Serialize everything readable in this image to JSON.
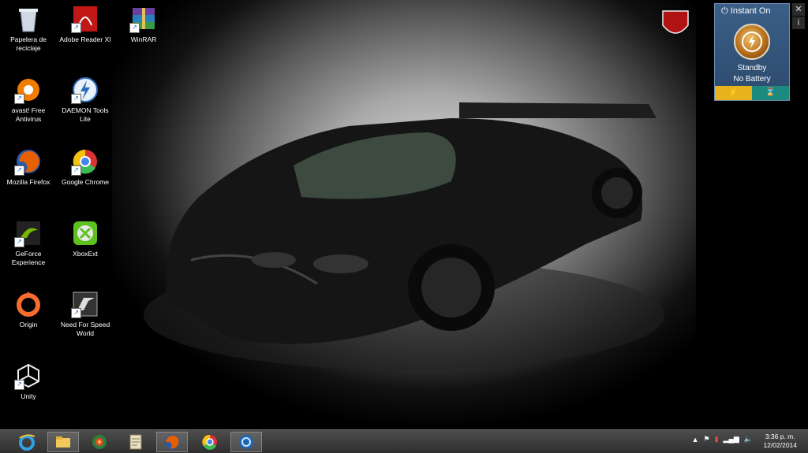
{
  "desktop": {
    "icons": [
      {
        "label": "Papelera de reciclaje",
        "icon": "recycle-bin-icon"
      },
      {
        "label": "Adobe Reader XI",
        "icon": "adobe-reader-icon"
      },
      {
        "label": "WinRAR",
        "icon": "winrar-icon"
      },
      {
        "label": "avast! Free Antivirus",
        "icon": "avast-icon"
      },
      {
        "label": "DAEMON Tools Lite",
        "icon": "daemon-tools-icon"
      },
      {
        "label": "Mozilla Firefox",
        "icon": "firefox-icon"
      },
      {
        "label": "Google Chrome",
        "icon": "chrome-icon"
      },
      {
        "label": "GeForce Experience",
        "icon": "geforce-icon"
      },
      {
        "label": "XboxExt",
        "icon": "xbox-icon"
      },
      {
        "label": "Origin",
        "icon": "origin-icon"
      },
      {
        "label": "Need For Speed World",
        "icon": "nfs-icon"
      },
      {
        "label": "Unity",
        "icon": "unity-icon"
      }
    ]
  },
  "gadget": {
    "title": "Instant On",
    "status": "Standby",
    "battery": "No Battery",
    "colors": {
      "left": "#e8b21c",
      "right": "#1d8a80"
    }
  },
  "taskbar": {
    "buttons": [
      {
        "icon": "internet-explorer-icon"
      },
      {
        "icon": "file-explorer-icon"
      },
      {
        "icon": "media-center-icon"
      },
      {
        "icon": "notepad-icon"
      },
      {
        "icon": "firefox-icon"
      },
      {
        "icon": "chrome-icon"
      },
      {
        "icon": "app-icon"
      }
    ],
    "tray_icons": [
      "show-hidden-icon",
      "flag-icon",
      "battery-icon",
      "signal-icon",
      "volume-icon"
    ],
    "clock": {
      "time": "3:36 p. m.",
      "date": "12/02/2014"
    }
  }
}
